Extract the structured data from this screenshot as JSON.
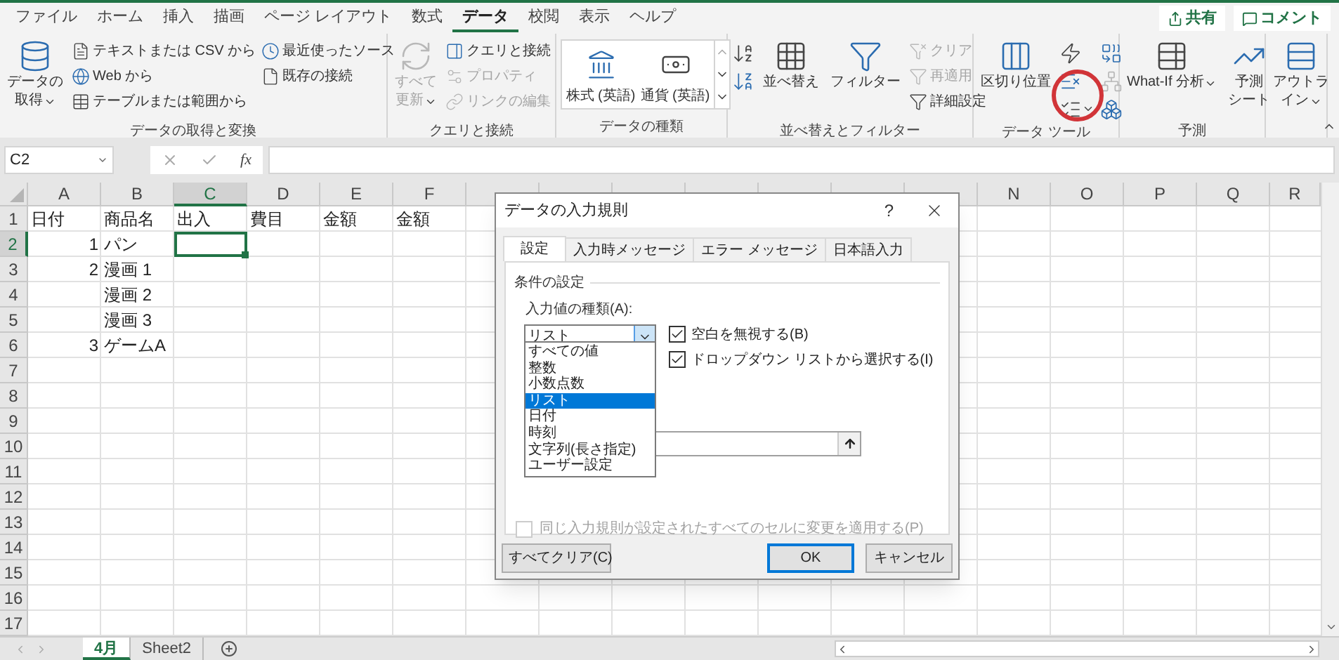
{
  "ribbon_tabs": [
    {
      "label": "ファイル",
      "selected": false
    },
    {
      "label": "ホーム",
      "selected": false
    },
    {
      "label": "挿入",
      "selected": false
    },
    {
      "label": "描画",
      "selected": false
    },
    {
      "label": "ページ レイアウト",
      "selected": false
    },
    {
      "label": "数式",
      "selected": false
    },
    {
      "label": "データ",
      "selected": true
    },
    {
      "label": "校閲",
      "selected": false
    },
    {
      "label": "表示",
      "selected": false
    },
    {
      "label": "ヘルプ",
      "selected": false
    }
  ],
  "header_buttons": [
    {
      "label": "共有",
      "kind": "share"
    },
    {
      "label": "コメント",
      "kind": "comment"
    }
  ],
  "ribbon_groups": [
    {
      "label": "データの取得と変換",
      "items": [
        {
          "lines": [
            "データの",
            "取得"
          ],
          "kind": "large",
          "disabled": false,
          "menu": true
        },
        {
          "label": "テキストまたは CSV から",
          "kind": "small",
          "disabled": false,
          "menu": false
        },
        {
          "label": "Web から",
          "kind": "small",
          "disabled": false,
          "menu": false
        },
        {
          "label": "テーブルまたは範囲から",
          "kind": "small",
          "disabled": false,
          "menu": false
        },
        {
          "label": "最近使ったソース",
          "kind": "small",
          "disabled": false,
          "menu": false
        },
        {
          "label": "既存の接続",
          "kind": "small",
          "disabled": false,
          "menu": false
        }
      ]
    },
    {
      "label": "クエリと接続",
      "items": [
        {
          "lines": [
            "すべて",
            "更新"
          ],
          "kind": "large",
          "disabled": true,
          "menu": true
        },
        {
          "label": "クエリと接続",
          "kind": "small",
          "disabled": false,
          "menu": false
        },
        {
          "label": "プロパティ",
          "kind": "small",
          "disabled": true,
          "menu": false
        },
        {
          "label": "リンクの編集",
          "kind": "small",
          "disabled": true,
          "menu": false
        }
      ]
    },
    {
      "label": "データの種類",
      "items": [
        {
          "label": "株式 (英語)",
          "kind": "gallery",
          "disabled": false,
          "menu": false
        },
        {
          "label": "通貨 (英語)",
          "kind": "gallery",
          "disabled": false,
          "menu": false
        }
      ]
    },
    {
      "label": "並べ替えとフィルター",
      "items": [
        {
          "kind": "icon",
          "disabled": false,
          "menu": false
        },
        {
          "kind": "icon",
          "disabled": false,
          "menu": false
        },
        {
          "label": "並べ替え",
          "kind": "large",
          "disabled": false,
          "menu": false
        },
        {
          "label": "フィルター",
          "kind": "large",
          "disabled": false,
          "menu": false
        },
        {
          "label": "クリア",
          "kind": "small",
          "disabled": true,
          "menu": false
        },
        {
          "label": "再適用",
          "kind": "small",
          "disabled": true,
          "menu": false
        },
        {
          "label": "詳細設定",
          "kind": "small",
          "disabled": false,
          "menu": false
        }
      ]
    },
    {
      "label": "データ ツール",
      "items": [
        {
          "label": "区切り位置",
          "kind": "large",
          "disabled": false,
          "menu": false
        },
        {
          "kind": "icon",
          "disabled": false,
          "menu": false
        },
        {
          "kind": "icon",
          "disabled": false,
          "menu": false
        },
        {
          "kind": "icon",
          "disabled": false,
          "menu": true
        },
        {
          "kind": "icon",
          "disabled": false,
          "menu": false
        },
        {
          "kind": "icon",
          "disabled": true,
          "menu": false
        },
        {
          "kind": "icon",
          "disabled": false,
          "menu": false
        }
      ]
    },
    {
      "label": "予測",
      "items": [
        {
          "label": "What-If 分析",
          "kind": "large",
          "disabled": false,
          "menu": true
        },
        {
          "lines": [
            "予測",
            "シート"
          ],
          "kind": "large",
          "disabled": false,
          "menu": false
        }
      ]
    },
    {
      "items": [
        {
          "lines": [
            "アウトラ",
            "イン"
          ],
          "kind": "large",
          "disabled": false,
          "menu": true
        }
      ]
    }
  ],
  "annotations": [
    {
      "kind": "circle",
      "color": "#d13438"
    }
  ],
  "formula_bar": {
    "name_box": "C2",
    "function_label": "fx"
  },
  "sheet": {
    "columns": [
      {
        "label": "A",
        "selected": false
      },
      {
        "label": "B",
        "selected": false
      },
      {
        "label": "C",
        "selected": true
      },
      {
        "label": "D",
        "selected": false
      },
      {
        "label": "E",
        "selected": false
      },
      {
        "label": "F",
        "selected": false
      },
      {
        "selected": false
      },
      {
        "selected": false
      },
      {
        "selected": false
      },
      {
        "selected": false
      },
      {
        "selected": false
      },
      {
        "selected": false
      },
      {
        "selected": false
      },
      {
        "label": "N",
        "selected": false
      },
      {
        "label": "O",
        "selected": false
      },
      {
        "label": "P",
        "selected": false
      },
      {
        "label": "Q",
        "selected": false
      },
      {
        "label": "R",
        "selected": false
      }
    ],
    "rows": [
      {
        "number": "1",
        "selected": false,
        "cells": [
          {
            "value": "日付",
            "kind": "text"
          },
          {
            "value": "商品名",
            "kind": "text"
          },
          {
            "value": "出入",
            "kind": "text"
          },
          {
            "value": "費目",
            "kind": "text"
          },
          {
            "value": "金額",
            "kind": "text"
          },
          {
            "value": "金額",
            "kind": "text"
          }
        ]
      },
      {
        "number": "2",
        "selected": true,
        "cells": [
          {
            "value": "1",
            "kind": "number"
          },
          {
            "value": "パン",
            "kind": "text"
          }
        ]
      },
      {
        "number": "3",
        "selected": false,
        "cells": [
          {
            "value": "2",
            "kind": "number"
          },
          {
            "value": "漫画 1",
            "kind": "text"
          }
        ]
      },
      {
        "number": "4",
        "selected": false,
        "cells": [
          {
            "kind": "empty"
          },
          {
            "value": "漫画 2",
            "kind": "text"
          }
        ]
      },
      {
        "number": "5",
        "selected": false,
        "cells": [
          {
            "kind": "empty"
          },
          {
            "value": "漫画 3",
            "kind": "text"
          }
        ]
      },
      {
        "number": "6",
        "selected": false,
        "cells": [
          {
            "value": "3",
            "kind": "number"
          },
          {
            "value": "ゲームA",
            "kind": "text"
          }
        ]
      },
      {
        "number": "7",
        "selected": false
      },
      {
        "number": "8",
        "selected": false
      },
      {
        "number": "9",
        "selected": false
      },
      {
        "number": "10",
        "selected": false
      },
      {
        "number": "11",
        "selected": false
      },
      {
        "number": "12",
        "selected": false
      },
      {
        "number": "13",
        "selected": false
      },
      {
        "number": "14",
        "selected": false
      },
      {
        "number": "15",
        "selected": false
      },
      {
        "number": "16",
        "selected": false
      },
      {
        "number": "17",
        "selected": false
      }
    ]
  },
  "sheet_tabs": [
    {
      "label": "4月",
      "selected": true
    },
    {
      "label": "Sheet2",
      "selected": false
    }
  ],
  "dialog": {
    "title": "データの入力規則",
    "help": "?",
    "tabs": [
      {
        "label": "設定",
        "selected": true
      },
      {
        "label": "入力時メッセージ",
        "selected": false
      },
      {
        "label": "エラー メッセージ",
        "selected": false
      },
      {
        "label": "日本語入力",
        "selected": false
      }
    ],
    "section_title": "条件の設定",
    "type_label": "入力値の種類(A):",
    "type_select": {
      "value": "リスト",
      "open": true,
      "options": [
        {
          "label": "すべての値",
          "selected": false
        },
        {
          "label": "整数",
          "selected": false
        },
        {
          "label": "小数点数",
          "selected": false
        },
        {
          "label": "リスト",
          "selected": true
        },
        {
          "label": "日付",
          "selected": false
        },
        {
          "label": "時刻",
          "selected": false
        },
        {
          "label": "文字列(長さ指定)",
          "selected": false
        },
        {
          "label": "ユーザー設定",
          "selected": false
        }
      ]
    },
    "checkboxes": [
      {
        "label": "空白を無視する(B)",
        "checked": true,
        "disabled": false
      },
      {
        "label": "ドロップダウン リストから選択する(I)",
        "checked": true,
        "disabled": false
      }
    ],
    "apply_all": {
      "label": "同じ入力規則が設定されたすべてのセルに変更を適用する(P)",
      "checked": false,
      "disabled": true
    },
    "buttons": [
      {
        "label": "すべてクリア(C)",
        "kind": "left"
      },
      {
        "label": "OK",
        "kind": "default"
      },
      {
        "label": "キャンセル",
        "kind": "normal"
      }
    ]
  }
}
